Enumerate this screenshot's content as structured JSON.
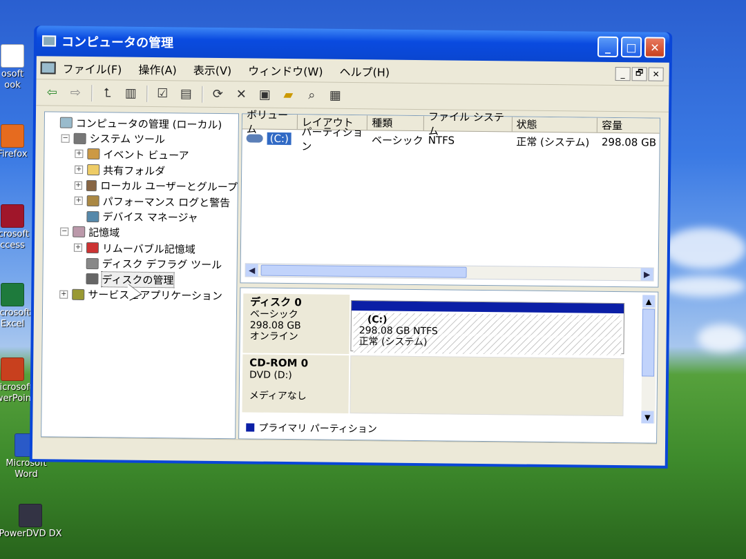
{
  "window": {
    "title": "コンピュータの管理",
    "controls": [
      "_",
      "□",
      "✕"
    ]
  },
  "menubar": {
    "items": [
      "ファイル(F)",
      "操作(A)",
      "表示(V)",
      "ウィンドウ(W)",
      "ヘルプ(H)"
    ],
    "mdi_controls": [
      "_",
      "🗗",
      "✕"
    ]
  },
  "toolbar": {
    "buttons": [
      "back-arrow",
      "forward-arrow",
      "up-folder",
      "show-hide-tree",
      "properties",
      "help",
      "refresh",
      "delete",
      "properties-sheet",
      "open",
      "search",
      "help-book"
    ]
  },
  "tree": {
    "nodes": [
      {
        "label": "コンピュータの管理 (ローカル)",
        "indent": 0,
        "exp": ""
      },
      {
        "label": "システム ツール",
        "indent": 1,
        "exp": "−"
      },
      {
        "label": "イベント ビューア",
        "indent": 2,
        "exp": "+"
      },
      {
        "label": "共有フォルダ",
        "indent": 2,
        "exp": "+"
      },
      {
        "label": "ローカル ユーザーとグループ",
        "indent": 2,
        "exp": "+"
      },
      {
        "label": "パフォーマンス ログと警告",
        "indent": 2,
        "exp": "+"
      },
      {
        "label": "デバイス マネージャ",
        "indent": 2,
        "exp": ""
      },
      {
        "label": "記憶域",
        "indent": 1,
        "exp": "−"
      },
      {
        "label": "リムーバブル記憶域",
        "indent": 2,
        "exp": "+"
      },
      {
        "label": "ディスク デフラグ ツール",
        "indent": 2,
        "exp": ""
      },
      {
        "label": "ディスクの管理",
        "indent": 2,
        "exp": "",
        "selected": true
      },
      {
        "label": "サービスとアプリケーション",
        "indent": 1,
        "exp": "+"
      }
    ]
  },
  "volume_list": {
    "columns": [
      "ボリューム",
      "レイアウト",
      "種類",
      "ファイル システム",
      "状態",
      "容量"
    ],
    "rows": [
      {
        "volume": "(C:)",
        "layout": "パーティション",
        "type": "ベーシック",
        "fs": "NTFS",
        "status": "正常 (システム)",
        "capacity": "298.08 GB"
      }
    ]
  },
  "disks": {
    "disk0": {
      "name": "ディスク 0",
      "type": "ベーシック",
      "size": "298.08 GB",
      "state": "オンライン"
    },
    "partition": {
      "name": "(C:)",
      "size_fs": "298.08 GB NTFS",
      "status": "正常 (システム)"
    },
    "cdrom": {
      "name": "CD-ROM 0",
      "drive": "DVD (D:)",
      "media": "メディアなし"
    }
  },
  "legend": {
    "label": "プライマリ パーティション"
  },
  "desktop": {
    "icons": [
      "osoft\nook",
      "Firefox",
      "icrosoft\nccess",
      "licrosoft\nExcel",
      "Microsoft\nowerPoint",
      "Microsoft\nWord",
      "PowerDVD DX"
    ]
  },
  "colors": {
    "titlebar": "#0a46d8",
    "primary_partition": "#0b1fa6",
    "selection": "#316ac5"
  }
}
